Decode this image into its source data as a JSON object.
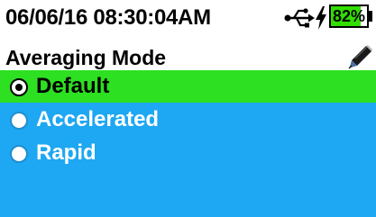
{
  "status": {
    "datetime": "06/06/16  08:30:04AM",
    "battery_percent": "82%",
    "battery_level": 0.82,
    "icons": [
      "usb-icon",
      "charging-bolt-icon",
      "battery-icon"
    ]
  },
  "header": {
    "title": "Averaging Mode",
    "edit_icon": "pen-icon"
  },
  "options": {
    "items": [
      {
        "label": "Default",
        "selected": true
      },
      {
        "label": "Accelerated",
        "selected": false
      },
      {
        "label": "Rapid",
        "selected": false
      }
    ]
  },
  "colors": {
    "list_background": "#1ea7f2",
    "selected_row": "#2de021",
    "battery_fill": "#33dd00"
  }
}
